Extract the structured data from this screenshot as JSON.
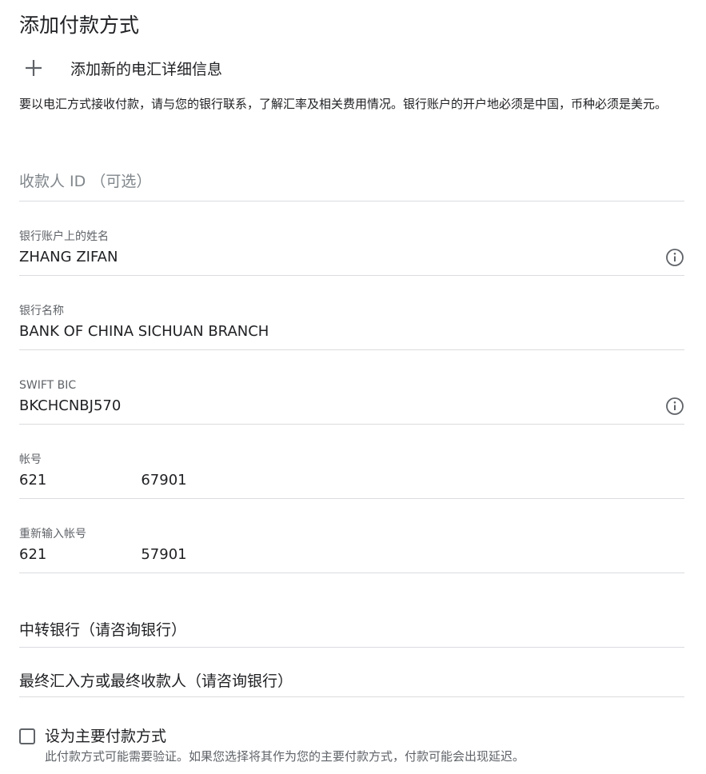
{
  "page": {
    "title": "添加付款方式"
  },
  "add_wire": {
    "label": "添加新的电汇详细信息",
    "icon": "plus-icon"
  },
  "description": "要以电汇方式接收付款，请与您的银行联系，了解汇率及相关费用情况。银行账户的开户地必须是中国，币种必须是美元。",
  "fields": {
    "payee_id": {
      "placeholder": "收款人 ID （可选）"
    },
    "account_name": {
      "label": "银行账户上的姓名",
      "value": "ZHANG ZIFAN",
      "icon": "info-icon"
    },
    "bank_name": {
      "label": "银行名称",
      "value": "BANK OF CHINA SICHUAN BRANCH"
    },
    "swift_bic": {
      "label": "SWIFT BIC",
      "value": "BKCHCNBJ570",
      "icon": "info-icon"
    },
    "account_number": {
      "label": "帐号",
      "value_prefix": "621",
      "value_suffix": "67901"
    },
    "account_number_confirm": {
      "label": "重新输入帐号",
      "value_prefix": "621",
      "value_suffix": "57901"
    },
    "intermediary_bank": {
      "label": "中转银行（请咨询银行）"
    },
    "final_beneficiary": {
      "label": "最终汇入方或最终收款人（请咨询银行）"
    }
  },
  "primary": {
    "checked": false,
    "label": "设为主要付款方式",
    "hint": "此付款方式可能需要验证。如果您选择将其作为您的主要付款方式，付款可能会出现延迟。"
  },
  "colors": {
    "text": "#202124",
    "label": "#5f6368",
    "placeholder": "#80868b",
    "divider": "#dadce0"
  }
}
